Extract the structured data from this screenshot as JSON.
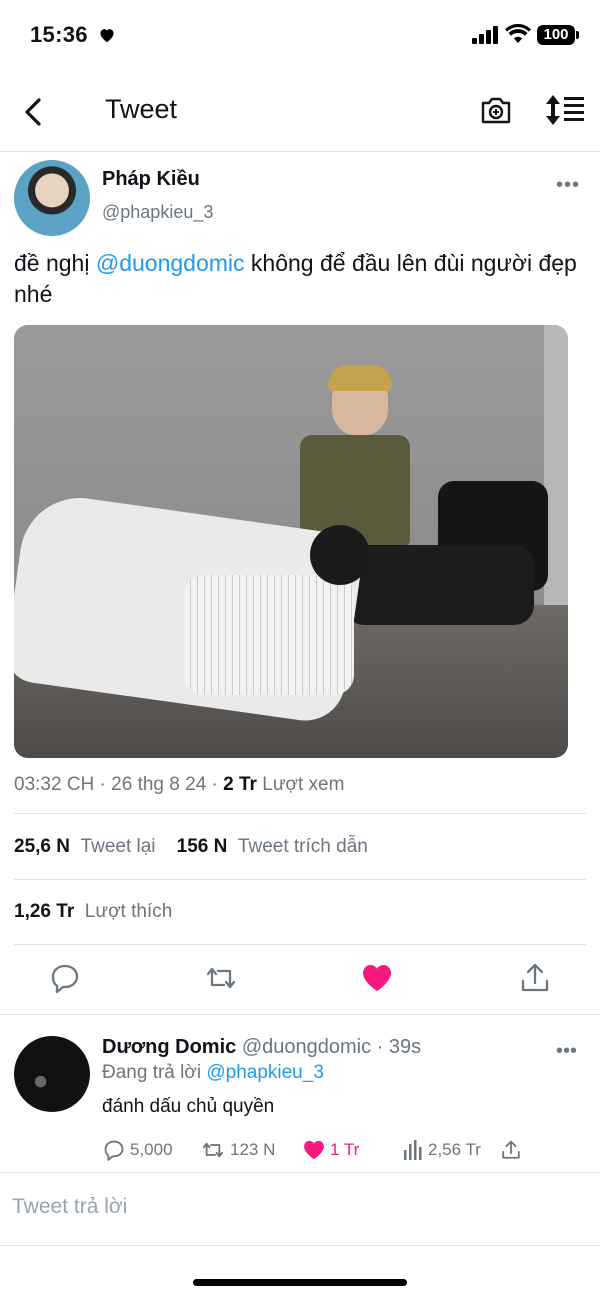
{
  "status_bar": {
    "time": "15:36",
    "battery": "100"
  },
  "nav": {
    "title": "Tweet",
    "icons": [
      "chevron-left-icon",
      "camera-icon",
      "sort-icon"
    ]
  },
  "tweet": {
    "author": {
      "name": "Pháp Kiều",
      "handle": "@phapkieu_3"
    },
    "text_before": "đề nghị ",
    "mention": "@duongdomic",
    "text_after": " không để đầu lên đùi người đẹp nhé",
    "meta": {
      "time": "03:32 CH",
      "date": "26 thg 8 24",
      "views_count": "2 Tr",
      "views_label": "Lượt xem"
    },
    "stats": {
      "retweets_count": "25,6 N",
      "retweets_label": "Tweet lại",
      "quotes_count": "156 N",
      "quotes_label": "Tweet trích dẫn",
      "likes_count": "1,26 Tr",
      "likes_label": "Lượt thích"
    },
    "liked": true
  },
  "reply": {
    "author": {
      "name": "Dương Domic",
      "handle": "@duongdomic",
      "time": "39s"
    },
    "replying_label": "Đang trả lời",
    "replying_to": "@phapkieu_3",
    "text": "đánh dấu chủ quyền",
    "counts": {
      "replies": "5,000",
      "retweets": "123 N",
      "likes": "1 Tr",
      "views": "2,56 Tr"
    }
  },
  "reply_box": {
    "placeholder": "Tweet trả lời"
  },
  "colors": {
    "accent": "#1d9bf0",
    "like": "#f91880",
    "muted": "#6b7680",
    "text": "#0f1419"
  }
}
